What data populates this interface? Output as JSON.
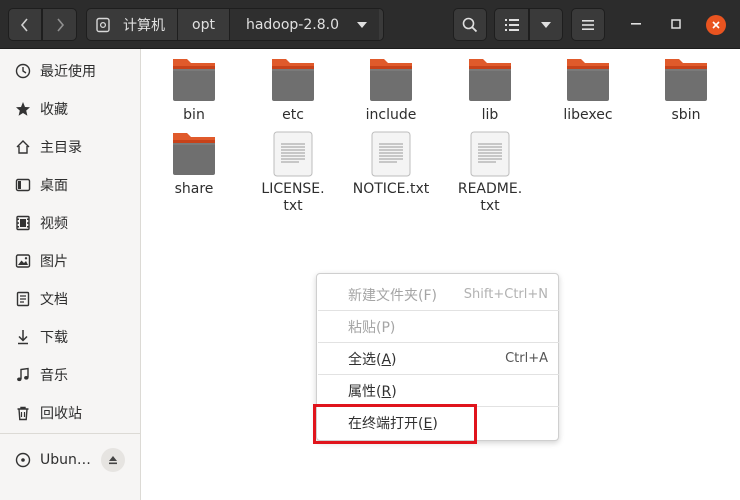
{
  "header": {
    "breadcrumbs": [
      "计算机",
      "opt",
      "hadoop-2.8.0"
    ]
  },
  "sidebar": {
    "items": [
      {
        "label": "最近使用",
        "icon": "clock-icon"
      },
      {
        "label": "收藏",
        "icon": "star-icon"
      },
      {
        "label": "主目录",
        "icon": "home-icon"
      },
      {
        "label": "桌面",
        "icon": "desktop-icon"
      },
      {
        "label": "视频",
        "icon": "video-icon"
      },
      {
        "label": "图片",
        "icon": "picture-icon"
      },
      {
        "label": "文档",
        "icon": "document-icon"
      },
      {
        "label": "下载",
        "icon": "download-icon"
      },
      {
        "label": "音乐",
        "icon": "music-icon"
      },
      {
        "label": "回收站",
        "icon": "trash-icon"
      }
    ],
    "device": {
      "label": "Ubun…",
      "icon": "disc-icon"
    }
  },
  "files": [
    {
      "name": "bin",
      "type": "folder"
    },
    {
      "name": "etc",
      "type": "folder"
    },
    {
      "name": "include",
      "type": "folder"
    },
    {
      "name": "lib",
      "type": "folder"
    },
    {
      "name": "libexec",
      "type": "folder"
    },
    {
      "name": "sbin",
      "type": "folder"
    },
    {
      "name": "share",
      "type": "folder"
    },
    {
      "name_line1": "LICENSE.",
      "name_line2": "txt",
      "type": "text"
    },
    {
      "name": "NOTICE.txt",
      "type": "text"
    },
    {
      "name_line1": "README.",
      "name_line2": "txt",
      "type": "text"
    }
  ],
  "context_menu": {
    "new_folder": {
      "label": "新建文件夹(",
      "mnemonic": "F",
      "suffix": ")",
      "accel": "Shift+Ctrl+N",
      "enabled": false
    },
    "paste": {
      "label": "粘贴(",
      "mnemonic": "P",
      "suffix": ")",
      "enabled": false
    },
    "select_all": {
      "label": "全选(",
      "mnemonic": "A",
      "suffix": ")",
      "accel": "Ctrl+A",
      "enabled": true
    },
    "properties": {
      "label": "属性(",
      "mnemonic": "R",
      "suffix": ")",
      "enabled": true
    },
    "open_terminal": {
      "label": "在终端打开(",
      "mnemonic": "E",
      "suffix": ")",
      "enabled": true
    }
  },
  "colors": {
    "accent": "#e95420",
    "folder_tab": "#e05a2b",
    "folder_body": "#6f6f6f",
    "highlight": "#e0141c"
  }
}
